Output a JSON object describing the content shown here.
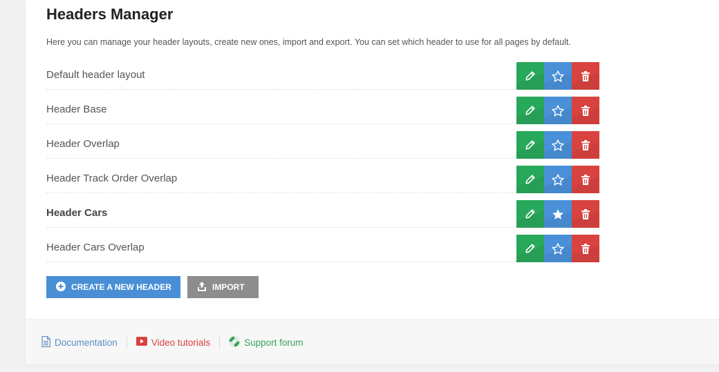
{
  "page": {
    "title": "Headers Manager",
    "description": "Here you can manage your header layouts, create new ones, import and export. You can set which header to use for all pages by default."
  },
  "headers": [
    {
      "name": "Default header layout",
      "is_default": false
    },
    {
      "name": "Header Base",
      "is_default": false
    },
    {
      "name": "Header Overlap",
      "is_default": false
    },
    {
      "name": "Header Track Order Overlap",
      "is_default": false
    },
    {
      "name": "Header Cars",
      "is_default": true
    },
    {
      "name": "Header Cars Overlap",
      "is_default": false
    }
  ],
  "actions": {
    "create_label": "CREATE A NEW HEADER",
    "import_label": "IMPORT"
  },
  "colors": {
    "edit": "#28a85a",
    "star": "#4a90d9",
    "delete": "#d9433f",
    "create": "#4a8fd6",
    "import": "#8d8d8d"
  },
  "footer": {
    "links": [
      {
        "label": "Documentation",
        "icon": "document-icon"
      },
      {
        "label": "Video tutorials",
        "icon": "youtube-icon"
      },
      {
        "label": "Support forum",
        "icon": "lifebuoy-icon"
      }
    ]
  }
}
